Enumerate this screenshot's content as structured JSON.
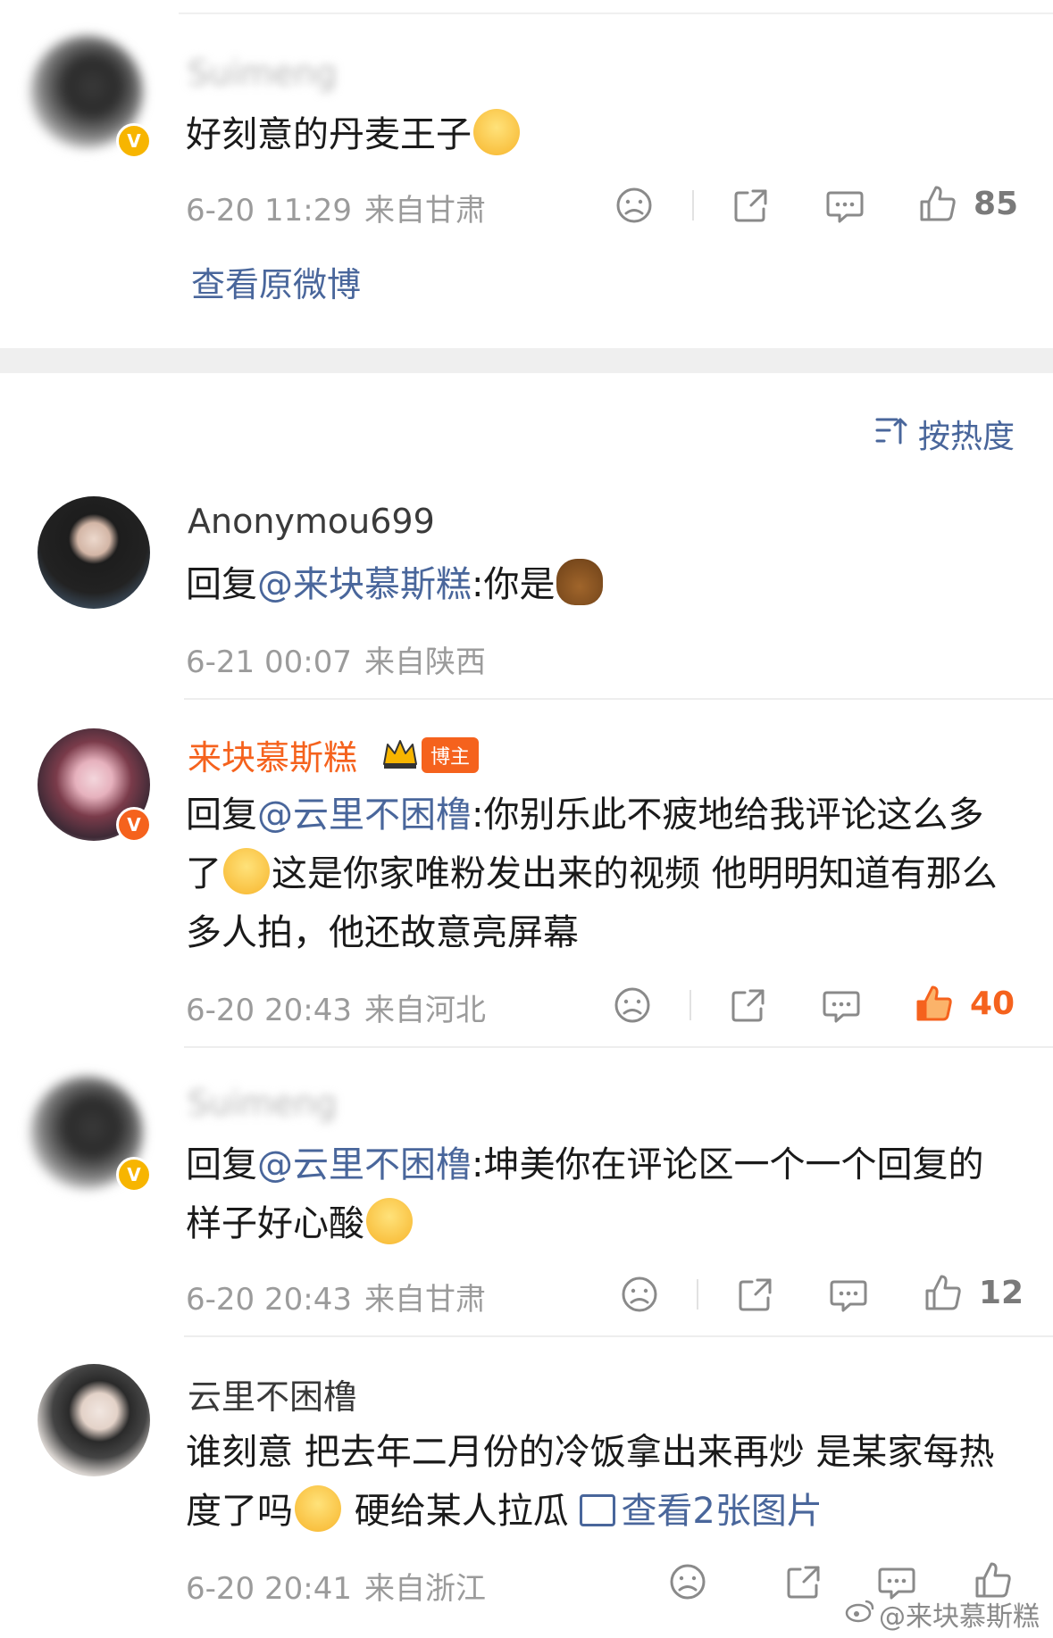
{
  "top_comment": {
    "username": "Suimeng",
    "text": "好刻意的丹麦王子",
    "emoji": "cry-face-emoji",
    "time": "6-20 11:29",
    "source": "来自甘肃",
    "likes": "85",
    "view_original": "查看原微博"
  },
  "sort": {
    "label": "按热度"
  },
  "comments": [
    {
      "username": "Anonymou699",
      "reply_prefix": "回复",
      "mention": "@来块慕斯糕",
      "text": ":你是",
      "emoji": "poop-emoji",
      "time": "6-21 00:07",
      "source": "来自陕西"
    },
    {
      "username": "来块慕斯糕",
      "badge": "博主",
      "reply_prefix": "回复",
      "mention": "@云里不困橹",
      "text_a": ":你别乐此不疲地给我评论这么多了",
      "text_b": "这是你家唯粉发出来的视频 他明明知道有那么多人拍，他还故意亮屏幕",
      "emoji": "laugh-cry-emoji",
      "time": "6-20 20:43",
      "source": "来自河北",
      "likes": "40"
    },
    {
      "username": "Suimeng",
      "reply_prefix": "回复",
      "mention": "@云里不困橹",
      "text": ":坤美你在评论区一个一个回复的样子好心酸",
      "emoji": "cry-face-emoji",
      "time": "6-20 20:43",
      "source": "来自甘肃",
      "likes": "12"
    },
    {
      "username": "云里不困橹",
      "text_a": "谁刻意 把去年二月份的冷饭拿出来再炒 是某家每热度了吗",
      "text_b": " 硬给某人拉瓜 ",
      "view_images": "查看2张图片",
      "emoji": "blush-emoji",
      "time": "6-20 20:41",
      "source": "来自浙江"
    }
  ],
  "watermark": "@来块慕斯糕",
  "colors": {
    "accent": "#f5621d",
    "link": "#49669b",
    "meta": "#9b9b9b"
  }
}
